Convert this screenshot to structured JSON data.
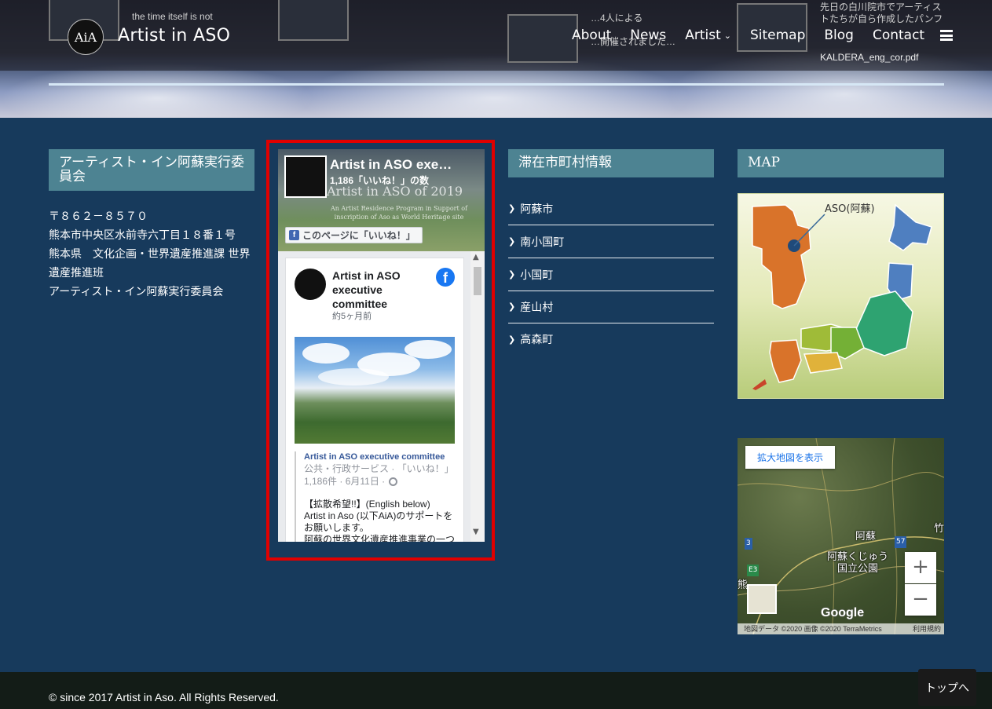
{
  "header": {
    "site_title": "Artist in ASO",
    "logo_text": "AiA",
    "nav": [
      {
        "label": "About"
      },
      {
        "label": "News"
      },
      {
        "label": "Artist"
      },
      {
        "label": "Sitemap"
      },
      {
        "label": "Blog"
      },
      {
        "label": "Contact"
      }
    ],
    "ghost_texts": [
      "the time itself is not",
      "…4人による",
      "先日の白川院市でアーティストたちが自ら作成したパンフ",
      "KALDERA_eng_cor.pdf",
      "…開催されました…"
    ]
  },
  "committee": {
    "title": "アーティスト・イン阿蘇実行委員会",
    "address_lines": [
      "〒８６２－８５７０",
      "熊本市中央区水前寺六丁目１８番１号",
      "熊本県　文化企画・世界遺産推進課 世界遺産推進班",
      "アーティスト・イン阿蘇実行委員会"
    ]
  },
  "facebook": {
    "page_name": "Artist in ASO exe…",
    "likes": "1,186「いいね！」の数",
    "cover_caption": "Artist in ASO of 2019",
    "cover_subcaption": "An Artist Residence Program in Support of inscription of Aso as World Heritage site",
    "like_button": "このページに「いいね！」",
    "post_author": "Artist in ASO executive committee",
    "post_time": "約5ヶ月前",
    "shared_name": "Artist in ASO executive committee",
    "shared_category": "公共・行政サービス · 「いいね！」",
    "shared_meta": "1,186件 · 6月11日 ·",
    "post_body": "【拡散希望!!】(English below)\nArtist in Aso (以下AiA)のサポートをお願いします。\n阿蘇の世界文化遺産推進事業の一つ"
  },
  "municipalities": {
    "title": "滞在市町村情報",
    "items": [
      "阿蘇市",
      "南小国町",
      "小国町",
      "産山村",
      "高森町"
    ]
  },
  "map": {
    "title": "MAP",
    "label": "ASO(阿蘇)"
  },
  "gmap": {
    "enlarge": "拡大地図を表示",
    "labels": {
      "aso": "阿蘇",
      "park": "阿蘇くじゅう\n国立公園",
      "take": "竹",
      "kuma": "熊"
    },
    "road_labels": {
      "r3": "3",
      "r57": "57",
      "e3": "E3"
    },
    "attribution": "地図データ ©2020 画像 ©2020 TerraMetrics",
    "terms": "利用規約",
    "google": "Google"
  },
  "footer": {
    "copyright": "© since 2017 Artist in Aso. All Rights Reserved.",
    "to_top": "トップへ"
  },
  "colors": {
    "page_bg": "#173a5c",
    "section_header": "#4d8392",
    "highlight": "#e00000",
    "facebook": "#1877f2"
  }
}
